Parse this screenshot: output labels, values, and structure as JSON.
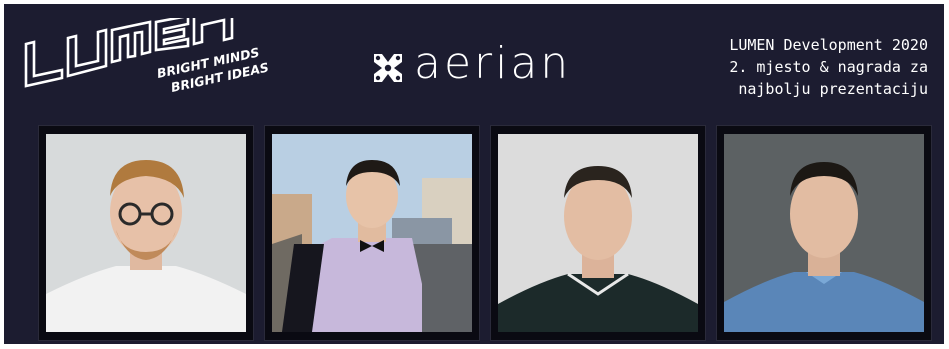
{
  "lumen_logo": {
    "word": "LUMEN",
    "tagline_line1": "BRIGHT MINDS",
    "tagline_line2": "BRIGHT IDEAS"
  },
  "sponsor": {
    "name": "aerian",
    "icon": "drone-icon"
  },
  "award": {
    "line1": "LUMEN Development 2020",
    "line2": "2. mjesto & nagrada za",
    "line3": "najbolju prezentaciju"
  },
  "colors": {
    "banner_background": "#1c1c30",
    "frame": "#0a0a12",
    "text": "#ffffff"
  },
  "team_photos": [
    {
      "icon": "person-portrait-icon"
    },
    {
      "icon": "person-portrait-icon"
    },
    {
      "icon": "person-portrait-icon"
    },
    {
      "icon": "person-portrait-icon"
    }
  ]
}
